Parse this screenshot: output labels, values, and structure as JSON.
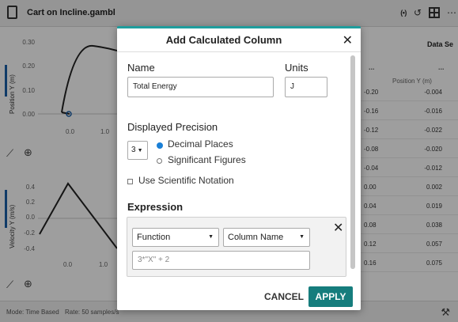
{
  "window": {
    "file_title": "Cart on Incline.gambl"
  },
  "graphs": {
    "position": {
      "axis_label": "Position Y (m)",
      "y_ticks": [
        "0.30",
        "0.20",
        "0.10",
        "0.00"
      ],
      "x_ticks": [
        "0.0",
        "1.0"
      ]
    },
    "velocity": {
      "axis_label": "Velocity Y (m/s)",
      "y_ticks": [
        "0.4",
        "0.2",
        "0.0",
        "-0.2",
        "-0.4"
      ],
      "x_ticks": [
        "0.0",
        "1.0"
      ]
    }
  },
  "table": {
    "title": "Data Se",
    "col_header": "Position Y (m)",
    "col_menu": "...",
    "left_menu": "...",
    "rows": [
      {
        "c1": "-0.20",
        "c2": "-0.004"
      },
      {
        "c1": "-0.16",
        "c2": "-0.016"
      },
      {
        "c1": "-0.12",
        "c2": "-0.022"
      },
      {
        "c1": "-0.08",
        "c2": "-0.020"
      },
      {
        "c1": "-0.04",
        "c2": "-0.012"
      },
      {
        "c1": "0.00",
        "c2": "0.002"
      },
      {
        "c1": "0.04",
        "c2": "0.019"
      },
      {
        "c1": "0.08",
        "c2": "0.038"
      },
      {
        "c1": "0.12",
        "c2": "0.057"
      },
      {
        "c1": "0.16",
        "c2": "0.075"
      }
    ]
  },
  "statusbar": {
    "mode": "Mode: Time Based",
    "rate": "Rate: 50 samples/s"
  },
  "dialog": {
    "title": "Add Calculated Column",
    "close_glyph": "✕",
    "name_label": "Name",
    "name_value": "Total Energy",
    "units_label": "Units",
    "units_value": "J",
    "precision_label": "Displayed Precision",
    "precision_value": "3",
    "decimal_places_label": "Decimal Places",
    "significant_figures_label": "Significant Figures",
    "scientific_label": "Use Scientific Notation",
    "expression_label": "Expression",
    "function_select": "Function",
    "column_select": "Column Name",
    "remove_glyph": "✕",
    "expression_placeholder": "3*\"X\" + 2",
    "cancel_label": "CANCEL",
    "apply_label": "APPLY"
  },
  "colors": {
    "accent": "#167d7d",
    "radio_on": "#1a7fd6",
    "axis_blue": "#1a5fa8"
  }
}
